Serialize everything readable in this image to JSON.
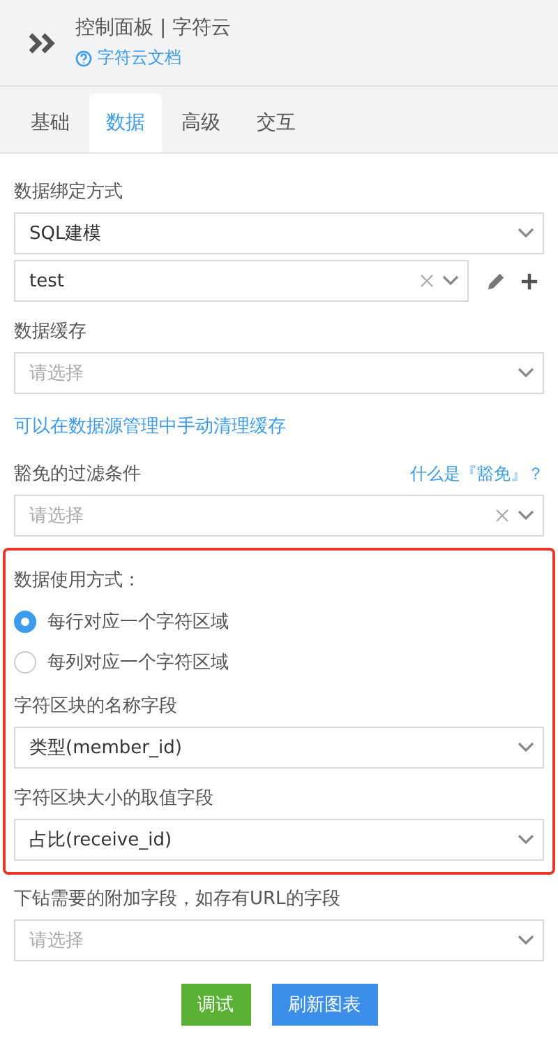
{
  "header": {
    "title": "控制面板 | 字符云",
    "doc_link": "字符云文档"
  },
  "tabs": [
    {
      "label": "基础",
      "selected": false
    },
    {
      "label": "数据",
      "selected": true
    },
    {
      "label": "高级",
      "selected": false
    },
    {
      "label": "交互",
      "selected": false
    }
  ],
  "form": [
    {
      "kind": "select",
      "label": "数据绑定方式",
      "value": "SQL建模",
      "clearable": false
    },
    {
      "kind": "select",
      "value": "test",
      "clearable": true,
      "actions": true
    },
    {
      "kind": "select",
      "label": "数据缓存",
      "placeholder": "请选择",
      "clearable": false
    },
    {
      "kind": "link",
      "text": "可以在数据源管理中手动清理缓存"
    },
    {
      "kind": "select",
      "label": "豁免的过滤条件",
      "help_link": "什么是『豁免』？",
      "placeholder": "请选择",
      "clearable": true
    },
    {
      "kind": "group",
      "highlighted": true,
      "items": [
        {
          "kind": "radio",
          "label": "数据使用方式：",
          "options": [
            {
              "label": "每行对应一个字符区域",
              "selected": true
            },
            {
              "label": "每列对应一个字符区域",
              "selected": false
            }
          ]
        },
        {
          "kind": "select",
          "label": "字符区块的名称字段",
          "value": "类型(member_id)",
          "clearable": false
        },
        {
          "kind": "select",
          "label": "字符区块大小的取值字段",
          "value": "占比(receive_id)",
          "clearable": false
        }
      ]
    },
    {
      "kind": "select",
      "label": "下钻需要的附加字段，如存有URL的字段",
      "placeholder": "请选择",
      "clearable": false
    }
  ],
  "buttons": [
    {
      "label": "调试",
      "kind": "success"
    },
    {
      "label": "刷新图表",
      "kind": "primary"
    }
  ]
}
